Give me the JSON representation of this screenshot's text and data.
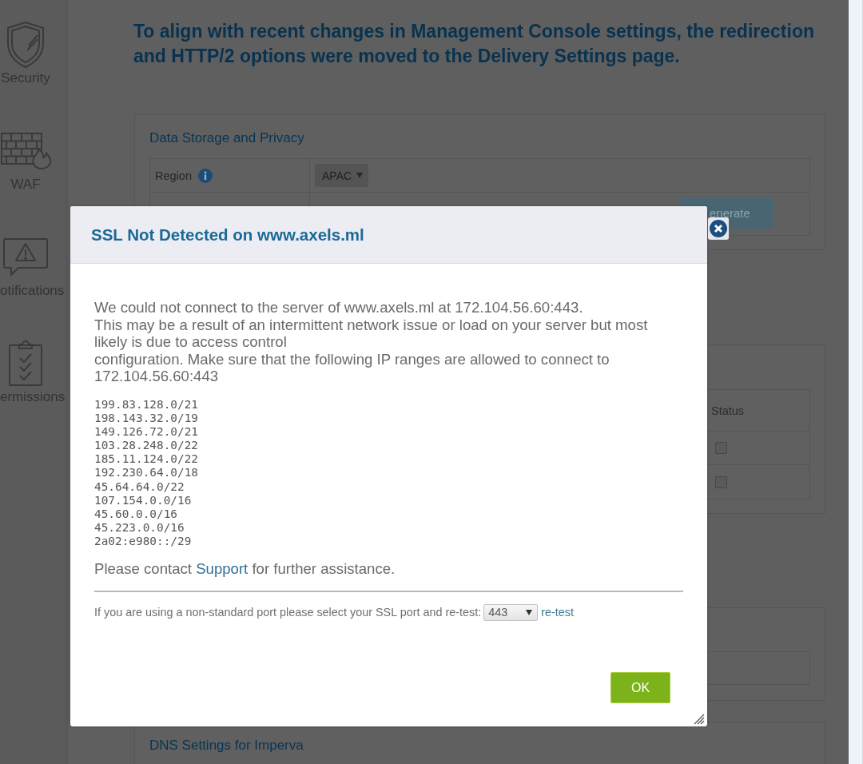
{
  "sidebar": {
    "items": [
      {
        "label": "Security"
      },
      {
        "label": "WAF"
      },
      {
        "label": "otifications"
      },
      {
        "label": "ermissions"
      }
    ]
  },
  "notice": "To align with recent changes in Management Console settings, the redirection and HTTP/2 options were moved to the Delivery Settings page.",
  "storage_panel": {
    "title": "Data Storage and Privacy",
    "region_label": "Region",
    "region_value": "APAC",
    "button": "enerate"
  },
  "status_table": {
    "column": "Status",
    "rows": [
      {
        "checked": false
      },
      {
        "checked": false
      }
    ]
  },
  "dns_panel": {
    "title": "DNS Settings for Imperva"
  },
  "dialog": {
    "title": "SSL Not Detected on www.axels.ml",
    "message_lines": [
      "We could not connect to the server of www.axels.ml at 172.104.56.60:443.",
      "This may be a result of an intermittent network issue or load on your server but most",
      "likely is due to access control",
      "configuration. Make sure that the following IP ranges are allowed to connect to",
      "172.104.56.60:443"
    ],
    "ip_ranges": [
      "199.83.128.0/21",
      "198.143.32.0/19",
      "149.126.72.0/21",
      "103.28.248.0/22",
      "185.11.124.0/22",
      "192.230.64.0/18",
      "45.64.64.0/22",
      "107.154.0.0/16",
      "45.60.0.0/16",
      "45.223.0.0/16",
      "2a02:e980::/29"
    ],
    "support_note": {
      "before": "Please contact",
      "link": "Support",
      "after": "for further assistance."
    },
    "port_prompt": "If you are using a non-standard port please select your SSL port and re-test:",
    "port_select": "443",
    "retest_link": "re-test",
    "ok_button": "OK"
  }
}
